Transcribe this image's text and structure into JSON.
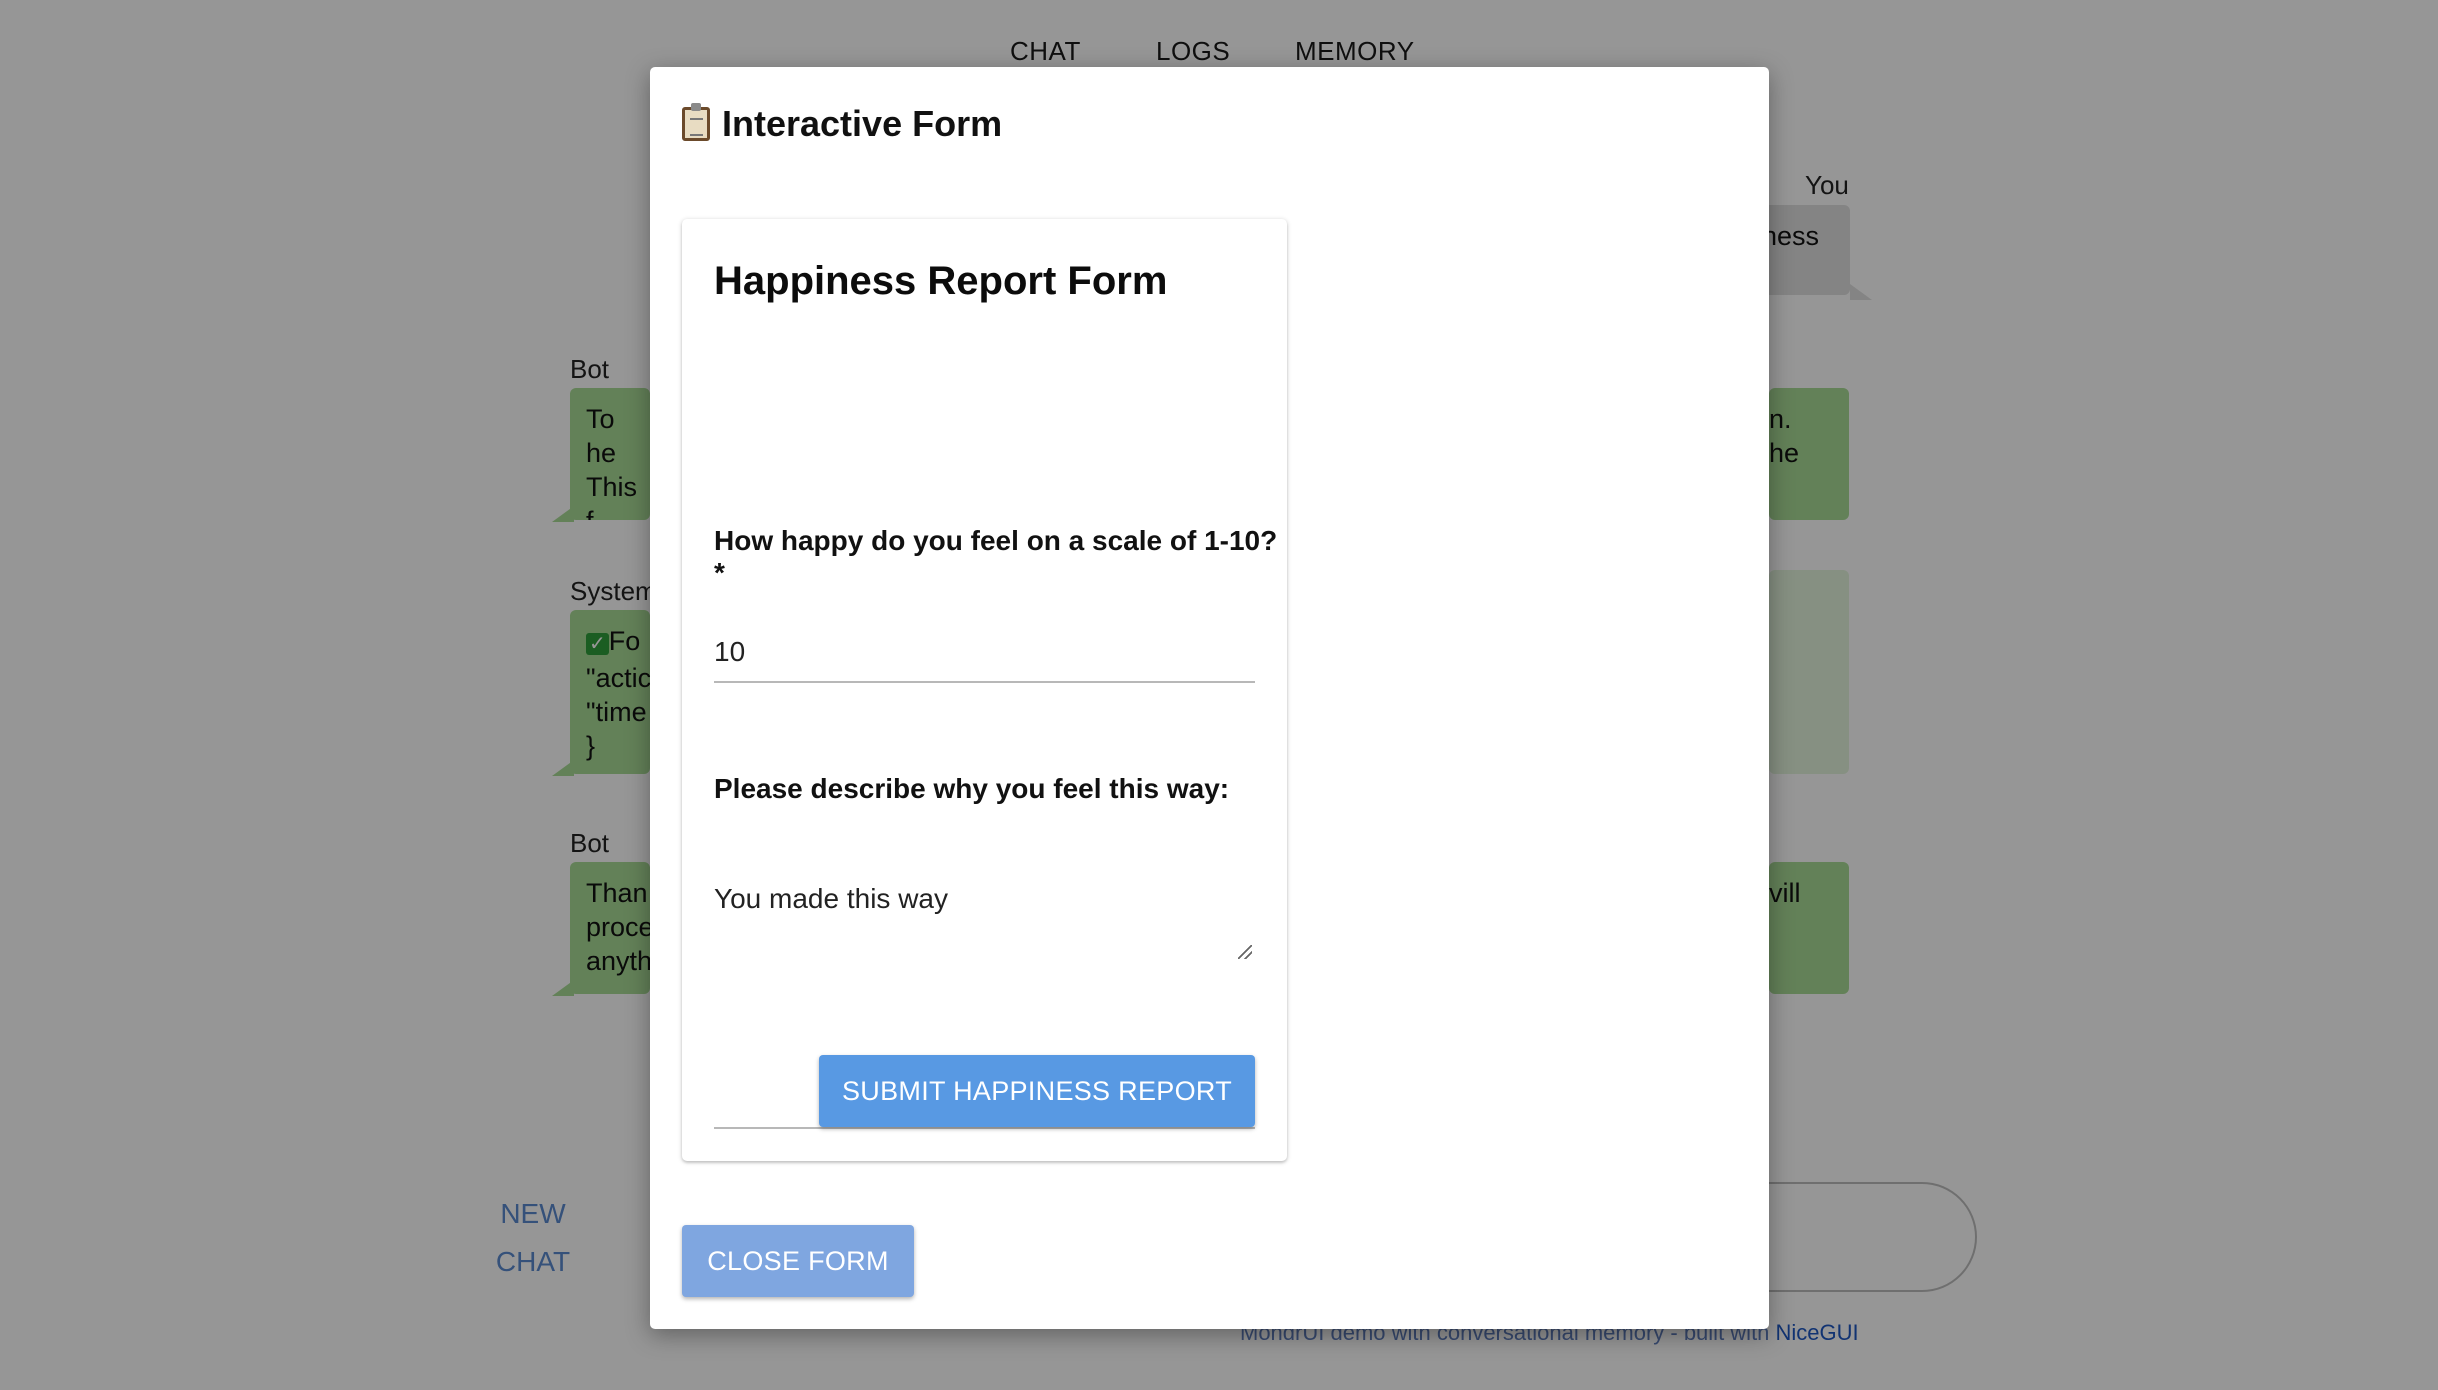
{
  "nav": {
    "tabs": [
      {
        "label": "CHAT"
      },
      {
        "label": "LOGS"
      },
      {
        "label": "MEMORY"
      }
    ]
  },
  "chat": {
    "messages": [
      {
        "sender": "You",
        "text": "iness"
      },
      {
        "sender": "Bot",
        "text_left": "To he\nThis f\nform:",
        "text_right": "n.\nhe"
      },
      {
        "sender": "System",
        "text_left": "Fo\n\"actic\n\"time\n}"
      },
      {
        "sender": "Bot",
        "text_left": "Than\nproce\nanyth",
        "text_right": "vill"
      }
    ],
    "new_chat_label": "NEW CHAT"
  },
  "footer": {
    "text": "MondrUI demo with conversational memory - built with ",
    "link": "NiceGUI"
  },
  "dialog": {
    "title": "Interactive Form",
    "icon": "clipboard-icon",
    "form": {
      "title": "Happiness Report Form",
      "fields": [
        {
          "label": "How happy do you feel on a scale of 1-10?*",
          "value": "10"
        },
        {
          "label": "Please describe why you feel this way:",
          "value": "You made this way"
        }
      ],
      "submit_label": "SUBMIT HAPPINESS REPORT"
    },
    "close_label": "CLOSE FORM"
  },
  "colors": {
    "accent": "#5899e3",
    "bot_bubble": "#a9dc96",
    "user_bubble": "#e0e0e0",
    "overlay": "rgba(0,0,0,0.41)"
  }
}
